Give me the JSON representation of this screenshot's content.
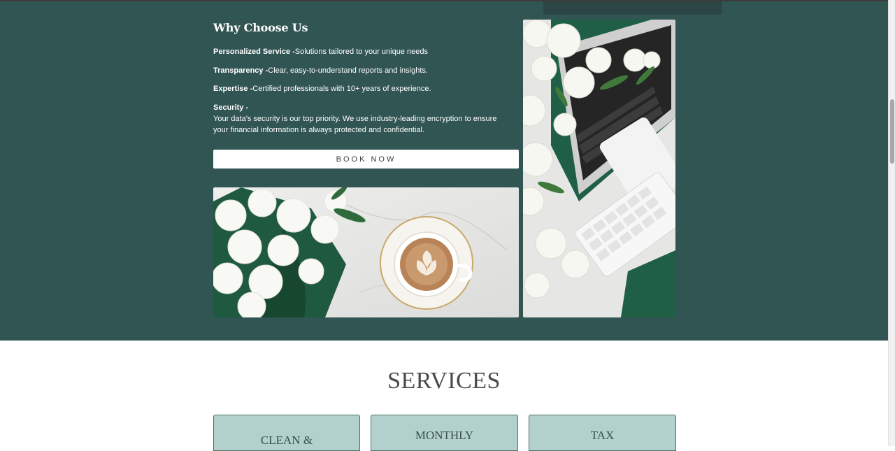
{
  "why_choose": {
    "title": "Why Choose Us",
    "features": [
      {
        "label": "Personalized Service -",
        "text": "Solutions tailored to your unique needs"
      },
      {
        "label": "Transparency -",
        "text": "Clear, easy-to-understand reports and insights."
      },
      {
        "label": "Expertise -",
        "text": "Certified professionals with 10+ years of experience."
      },
      {
        "label": "Security -",
        "text": "Your data's security is our top priority. We use industry-leading encryption to ensure your financial information is always protected and confidential."
      }
    ],
    "book_button": "BOOK NOW"
  },
  "services": {
    "title": "SERVICES",
    "cards": [
      "CLEAN &",
      "MONTHLY",
      "TAX"
    ]
  },
  "colors": {
    "hero_background": "#315553",
    "card_background": "#b3d1cc",
    "button_background": "#ffffff"
  },
  "images": [
    {
      "name": "coffee-flowers-photo",
      "icon": "photo"
    },
    {
      "name": "flowers-laptop-photo",
      "icon": "photo"
    }
  ]
}
